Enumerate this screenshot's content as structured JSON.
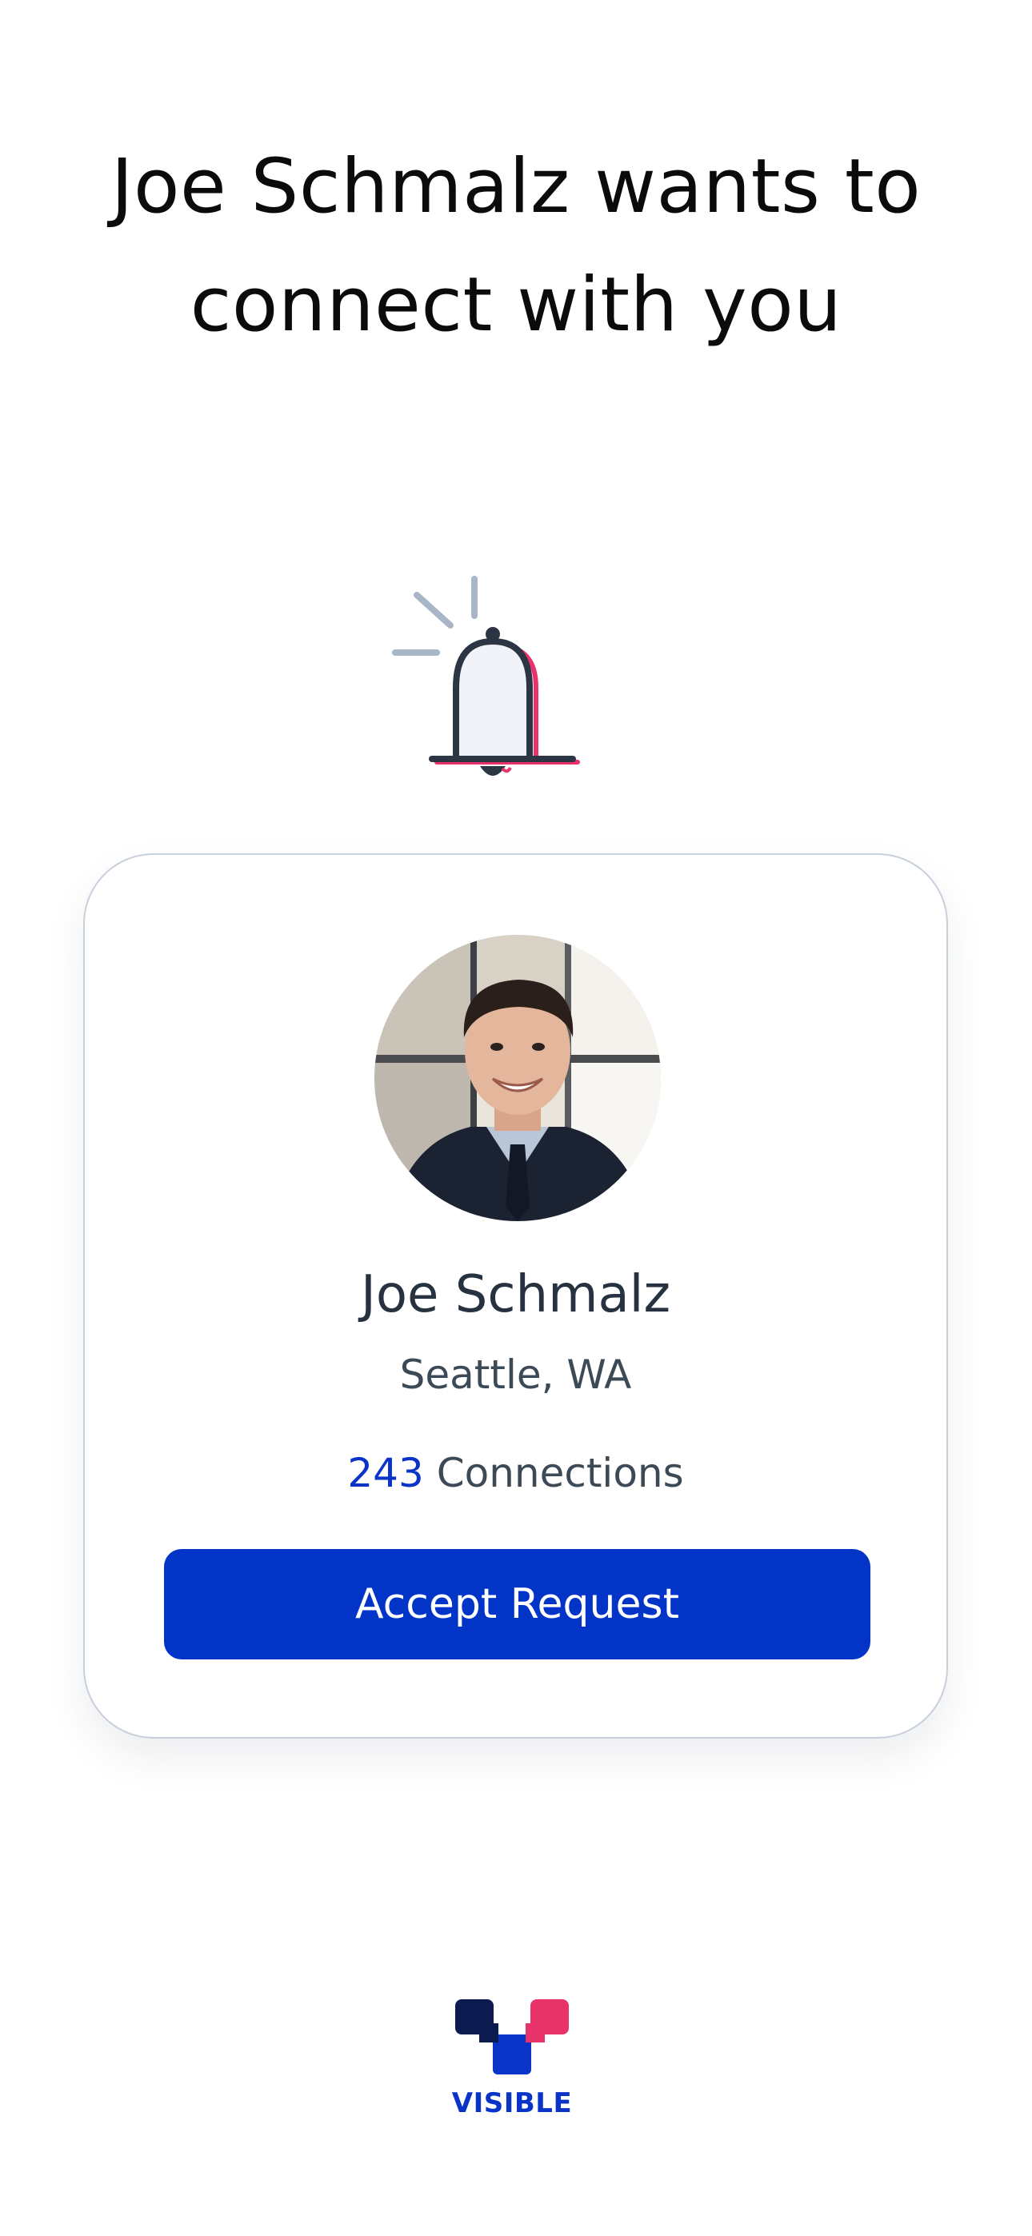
{
  "headline": "Joe Schmalz wants to connect with you",
  "icons": {
    "alert": "bell-icon",
    "avatar": "profile-photo",
    "brand": "visible-logo-mark"
  },
  "profile": {
    "name": "Joe Schmalz",
    "location": "Seattle, WA",
    "connections_count": "243",
    "connections_label": "Connections"
  },
  "actions": {
    "accept_label": "Accept Request"
  },
  "brand": {
    "name": "VISIBLE"
  },
  "colors": {
    "accent": "#0334C8",
    "brand_pink": "#E8336A",
    "brand_navy": "#0B1A4F",
    "text_primary": "#26323F",
    "card_border": "#C7D0DB"
  }
}
